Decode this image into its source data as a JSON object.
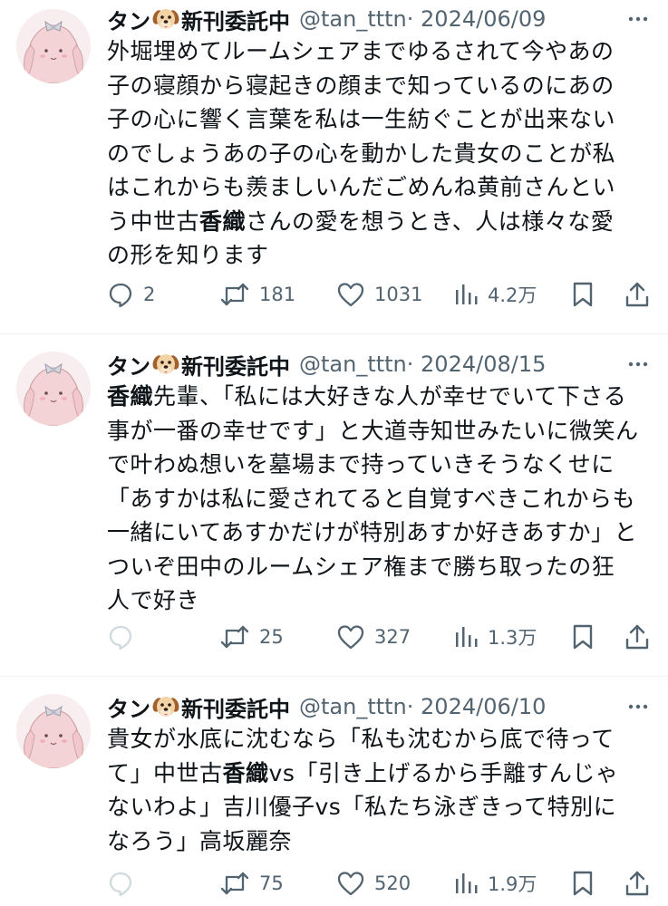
{
  "tweets": [
    {
      "name_left": "タン",
      "name_right": "新刊委託中",
      "handle": "@tan_tttn",
      "date": "· 2024/06/09",
      "lines": [
        [
          "外堀埋めてルームシェアまでゆるされて今やあの"
        ],
        [
          "子の寝顔から寝起きの顔まで知っているのにあの"
        ],
        [
          "子の心に響く言葉を私は一生紡ぐことが出来ない"
        ],
        [
          "のでしょうあの子の心を動かした貴女のことが私"
        ],
        [
          "はこれからも羨ましいんだごめんね黄前さんとい"
        ],
        [
          "う中世古",
          "香織",
          "さんの愛を想うとき、人は様々な愛"
        ],
        [
          "の形を知ります"
        ]
      ],
      "replies": "2",
      "retweets": "181",
      "likes": "1031",
      "views": "4.2万"
    },
    {
      "name_left": "タン",
      "name_right": "新刊委託中",
      "handle": "@tan_tttn",
      "date": "· 2024/08/15",
      "lines": [
        [
          "",
          "香織",
          "先輩、「私には大好きな人が幸せでいて下さる"
        ],
        [
          "事が一番の幸せです」と大道寺知世みたいに微笑ん"
        ],
        [
          "で叶わぬ想いを墓場まで持っていきそうなくせに"
        ],
        [
          "「あすかは私に愛されてると自覚すべきこれからも"
        ],
        [
          "一緒にいてあすかだけが特別あすか好きあすか」と"
        ],
        [
          "ついぞ田中のルームシェア権まで勝ち取ったの狂"
        ],
        [
          "人で好き"
        ]
      ],
      "replies": "",
      "retweets": "25",
      "likes": "327",
      "views": "1.3万"
    },
    {
      "name_left": "タン",
      "name_right": "新刊委託中",
      "handle": "@tan_tttn",
      "date": "· 2024/06/10",
      "lines": [
        [
          "貴女が水底に沈むなら「私も沈むから底で待って"
        ],
        [
          "て」中世古",
          "香織",
          "vs「引き上げるから手離すんじゃ"
        ],
        [
          "ないわよ」吉川優子vs「私たち泳ぎきって特別に"
        ],
        [
          "なろう」高坂麗奈"
        ]
      ],
      "replies": "",
      "retweets": "75",
      "likes": "520",
      "views": "1.9万"
    }
  ],
  "icons": {
    "reply": "speech-bubble-icon",
    "retweet": "retweet-arrows-icon",
    "like": "heart-icon",
    "views": "bar-chart-icon",
    "bookmark": "bookmark-icon",
    "share": "share-upload-icon",
    "more": "more-dots-icon",
    "name_emoji": "dog-face-icon"
  },
  "colors": {
    "text": "#0f1419",
    "secondary": "#536471",
    "divider": "#eff3f4",
    "disabled_icon": "#cfd9de"
  }
}
